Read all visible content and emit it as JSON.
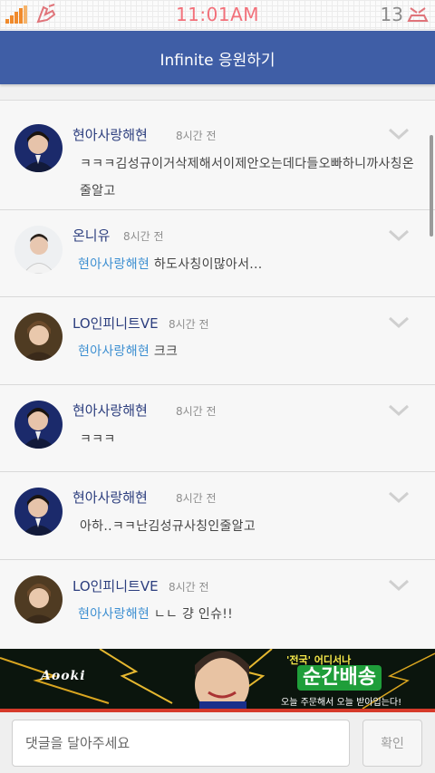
{
  "status_bar": {
    "time": "11:01AM",
    "battery_level": "13",
    "signal_icon": "signal-bars-icon",
    "notification_icon": "hand-icon",
    "battery_icon": "battery-icon"
  },
  "header": {
    "title": "Infinite 응원하기"
  },
  "comments": [
    {
      "author": "현아사랑해현",
      "time": "8시간 전",
      "mention": "",
      "text": "ㅋㅋㅋ김성규이거삭제해서이제안오는데다들오빠하니까사칭온줄알고",
      "avatar": "avatar-1"
    },
    {
      "author": "온니유",
      "time": "8시간 전",
      "mention": "현아사랑해현",
      "text": " 하도사칭이많아서...",
      "avatar": "avatar-2"
    },
    {
      "author": "LO인피니트VE",
      "time": "8시간 전",
      "mention": "현아사랑해현",
      "text": " 크크",
      "avatar": "avatar-3"
    },
    {
      "author": "현아사랑해현",
      "time": "8시간 전",
      "mention": "",
      "text": "ㅋㅋㅋ",
      "avatar": "avatar-1"
    },
    {
      "author": "현아사랑해현",
      "time": "8시간 전",
      "mention": "",
      "text": "아하..ㅋㅋ난김성규사칭인줄알고",
      "avatar": "avatar-1"
    },
    {
      "author": "LO인피니트VE",
      "time": "8시간 전",
      "mention": "현아사랑해현",
      "text": " ㄴㄴ 걍 인슈!!",
      "avatar": "avatar-3"
    }
  ],
  "ad": {
    "brand": "Aooki",
    "line1": "'전국' 어디서나",
    "line2": "순간배송",
    "line3": "오늘 주문해서 오늘 받아입는다!"
  },
  "input": {
    "placeholder": "댓글을 달아주세요",
    "value": ""
  },
  "confirm_button": {
    "label": "확인"
  },
  "colors": {
    "header": "#3f5ea6",
    "author": "#2c3e7e",
    "mention": "#3d8fd1",
    "clock": "#f2707a"
  }
}
